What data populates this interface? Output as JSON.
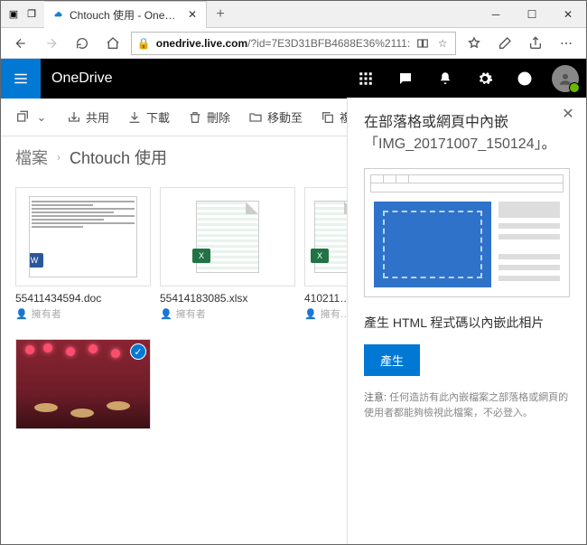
{
  "window": {
    "tab_title": "Chtouch 使用 - OneDri…"
  },
  "addressbar": {
    "domain": "onedrive.live.com",
    "path": "/?id=7E3D31BFB4688E36%2111:"
  },
  "app": {
    "brand": "OneDrive"
  },
  "toolbar": {
    "share": "共用",
    "download": "下載",
    "delete": "刪除",
    "move": "移動至",
    "copy": "複製至"
  },
  "breadcrumb": {
    "root": "檔案",
    "current": "Chtouch 使用"
  },
  "files": [
    {
      "name": "55411434594.doc",
      "meta": "擁有者",
      "type": "doc"
    },
    {
      "name": "55414183085.xlsx",
      "meta": "擁有者",
      "type": "xlsx"
    },
    {
      "name": "410211…",
      "meta": "擁有…",
      "type": "xlsx"
    },
    {
      "name": "",
      "meta": "",
      "type": "image",
      "selected": true
    }
  ],
  "panel": {
    "title_prefix": "在部落格或網頁中內嵌",
    "filename": "「IMG_20171007_150124」",
    "title_suffix": "。",
    "subtitle": "產生 HTML 程式碼以內嵌此相片",
    "button": "產生",
    "note_label": "注意:",
    "note_text": "任何造訪有此內嵌檔案之部落格或網頁的使用者都能夠檢視此檔案，不必登入。"
  }
}
